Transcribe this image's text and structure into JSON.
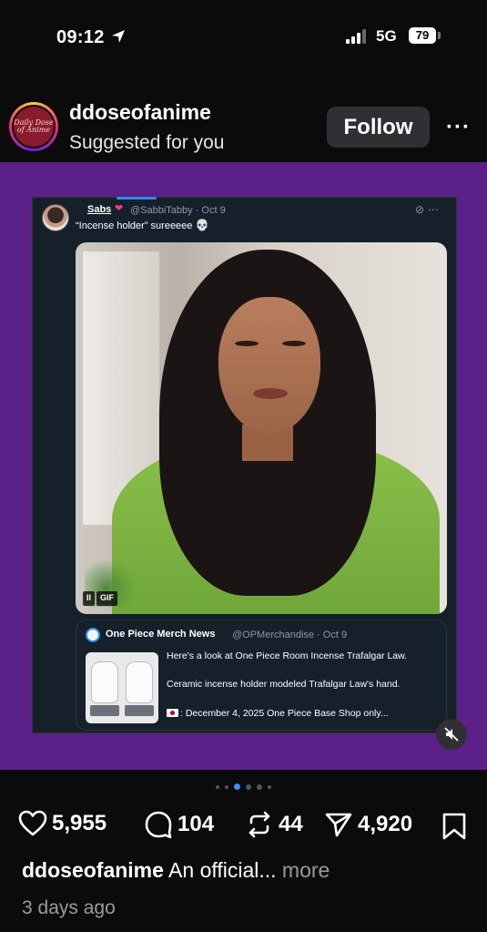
{
  "status_bar": {
    "time": "09:12",
    "network": "5G",
    "battery": "79"
  },
  "post": {
    "avatar_text": "Daily Dose of Anime",
    "username": "ddoseofanime",
    "subtitle": "Suggested for you",
    "follow_label": "Follow",
    "more_label": "···"
  },
  "tweet": {
    "author_name": "Sabs",
    "author_handle_date": "@SabbiTabby · Oct 9",
    "text": "“Incense holder” sureeeee",
    "gif_pause": "II",
    "gif_label": "GIF",
    "quote": {
      "name": "One Piece Merch News",
      "handle_date": "@OPMerchandise · Oct 9",
      "line1": "Here's a look at One Piece Room Incense Trafalgar Law.",
      "line2": "Ceramic incense holder modeled Trafalgar Law's hand.",
      "line3": ": December 4, 2025 One Piece Base Shop only..."
    }
  },
  "carousel": {
    "count": 6,
    "active_index": 2
  },
  "actions": {
    "likes": "5,955",
    "comments": "104",
    "reposts": "44",
    "shares": "4,920"
  },
  "caption": {
    "username": "ddoseofanime",
    "text": "An official...",
    "more": "more"
  },
  "time_ago": "3 days ago",
  "colors": {
    "background": "#0b0b0c",
    "media_bg": "#5a2088",
    "tweet_bg": "#15202b",
    "accent": "#3d8ef5"
  }
}
